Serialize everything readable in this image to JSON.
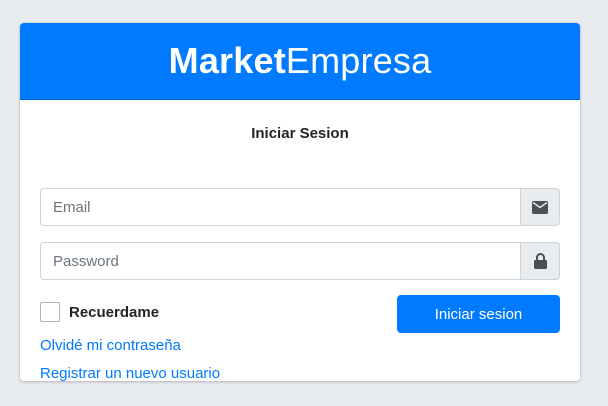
{
  "header": {
    "brand_bold": "Market",
    "brand_light": "Empresa"
  },
  "form": {
    "title": "Iniciar Sesion",
    "email": {
      "placeholder": "Email",
      "value": "",
      "icon": "envelope-icon"
    },
    "password": {
      "placeholder": "Password",
      "value": "",
      "icon": "lock-icon"
    },
    "remember_label": "Recuerdame",
    "remember_checked": false,
    "submit_label": "Iniciar sesion"
  },
  "links": {
    "forgot_password": "Olvidé mi contraseña",
    "register": "Registrar un nuevo usuario"
  },
  "colors": {
    "primary": "#007bff",
    "background": "#e9ecef",
    "addon_background": "#e9ecef",
    "text": "#212529"
  }
}
